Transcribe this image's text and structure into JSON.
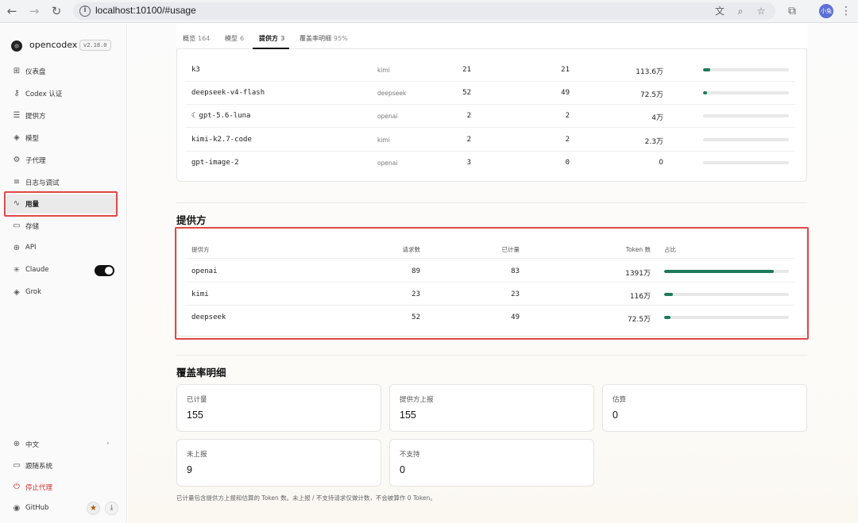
{
  "browser": {
    "url": "localhost:10100/#usage",
    "profile_label": "小兔"
  },
  "sidebar": {
    "brand": "opencodex",
    "version": "v2.18.0",
    "items": [
      {
        "label": "仪表盘",
        "icon": "grid-icon"
      },
      {
        "label": "Codex 认证",
        "icon": "key-icon"
      },
      {
        "label": "提供方",
        "icon": "server-icon"
      },
      {
        "label": "模型",
        "icon": "cube-icon"
      },
      {
        "label": "子代理",
        "icon": "robot-icon"
      },
      {
        "label": "日志与调试",
        "icon": "list-icon"
      },
      {
        "label": "用量",
        "icon": "activity-icon"
      },
      {
        "label": "存储",
        "icon": "drive-icon"
      },
      {
        "label": "API",
        "icon": "globe-icon"
      },
      {
        "label": "Claude",
        "icon": "sparkle-icon"
      },
      {
        "label": "Grok",
        "icon": "cube-icon"
      }
    ],
    "active_item": "用量",
    "claude_toggle_on": true,
    "footer": {
      "language": "中文",
      "follow_system": "跟随系统",
      "stop_proxy": "停止代理",
      "github": "GitHub"
    }
  },
  "tabs": [
    {
      "label": "概览",
      "count": "164"
    },
    {
      "label": "模型",
      "count": "6"
    },
    {
      "label": "提供方",
      "count": "3"
    },
    {
      "label": "覆盖率明细",
      "count": "95%"
    }
  ],
  "active_tab": "提供方",
  "models_table": {
    "rows": [
      {
        "name": "k3",
        "provider": "kimi",
        "requests": "21",
        "counted": "21",
        "tokens": "113.6万",
        "share": 0.08,
        "icon": ""
      },
      {
        "name": "deepseek-v4-flash",
        "provider": "deepseek",
        "requests": "52",
        "counted": "49",
        "tokens": "72.5万",
        "share": 0.05,
        "icon": ""
      },
      {
        "name": "gpt-5.6-luna",
        "provider": "openai",
        "requests": "2",
        "counted": "2",
        "tokens": "4万",
        "share": 0.0,
        "icon": "moon-icon"
      },
      {
        "name": "kimi-k2.7-code",
        "provider": "kimi",
        "requests": "2",
        "counted": "2",
        "tokens": "2.3万",
        "share": 0.0,
        "icon": ""
      },
      {
        "name": "gpt-image-2",
        "provider": "openai",
        "requests": "3",
        "counted": "0",
        "tokens": "0",
        "share": 0.0,
        "icon": ""
      }
    ]
  },
  "providers_section": {
    "title": "提供方",
    "headers": {
      "provider": "提供方",
      "requests": "请求数",
      "counted": "已计量",
      "tokens": "Token 数",
      "share": "占比"
    },
    "rows": [
      {
        "name": "openai",
        "requests": "89",
        "counted": "83",
        "tokens": "1391万",
        "share": 0.88
      },
      {
        "name": "kimi",
        "requests": "23",
        "counted": "23",
        "tokens": "116万",
        "share": 0.07
      },
      {
        "name": "deepseek",
        "requests": "52",
        "counted": "49",
        "tokens": "72.5万",
        "share": 0.05
      }
    ]
  },
  "coverage_section": {
    "title": "覆盖率明细",
    "cards": [
      {
        "label": "已计量",
        "value": "155"
      },
      {
        "label": "提供方上报",
        "value": "155"
      },
      {
        "label": "估算",
        "value": "0"
      },
      {
        "label": "未上报",
        "value": "9"
      },
      {
        "label": "不支持",
        "value": "0"
      }
    ],
    "footnote": "已计量包含提供方上报和估算的 Token 数。未上报 / 不支持请求仅做计数，不会被算作 0 Token。"
  },
  "colors": {
    "accent_bar": "#1e7a5a",
    "highlight_outline": "#e04848",
    "stop_red": "#d32f2f"
  }
}
